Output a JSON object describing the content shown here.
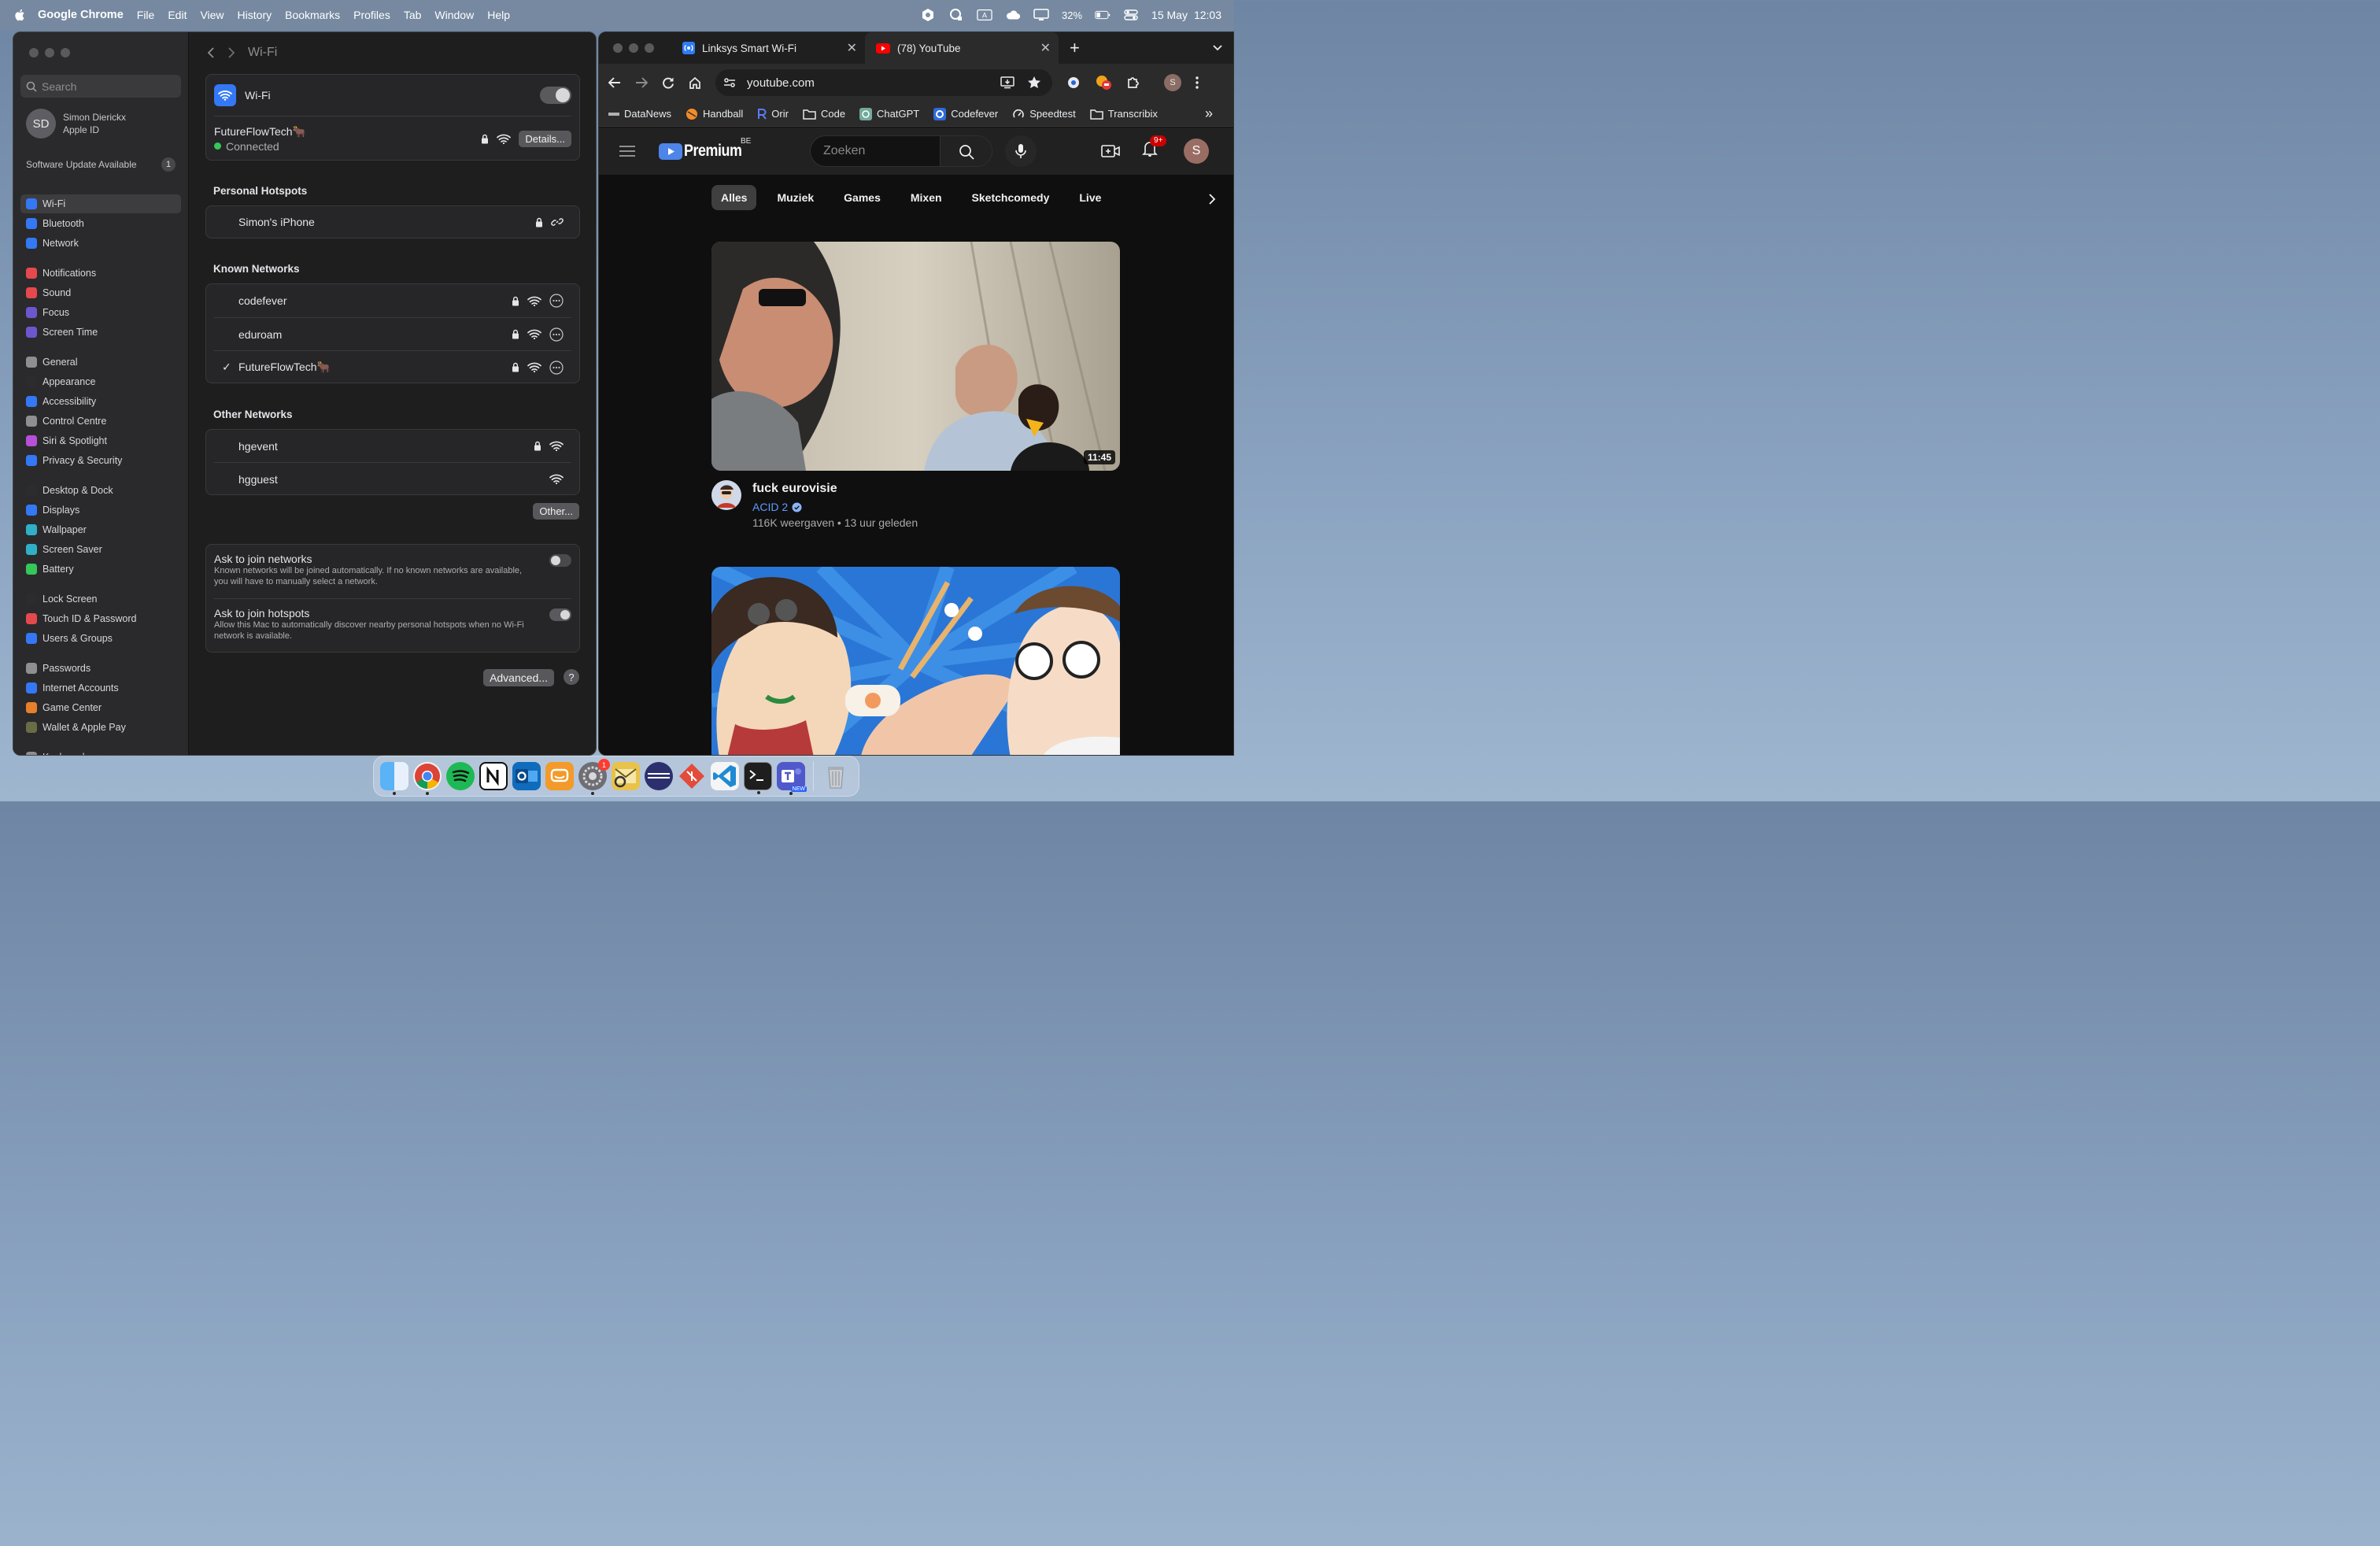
{
  "menubar": {
    "app_name": "Google Chrome",
    "items": [
      "File",
      "Edit",
      "View",
      "History",
      "Bookmarks",
      "Profiles",
      "Tab",
      "Window",
      "Help"
    ],
    "battery": "32%",
    "date": "15 May",
    "time": "12:03",
    "input_source": "A"
  },
  "settings": {
    "search_placeholder": "Search",
    "account": {
      "initials": "SD",
      "name": "Simon Dierickx",
      "sub": "Apple ID"
    },
    "update": {
      "label": "Software Update Available",
      "count": "1"
    },
    "sidebar": [
      {
        "label": "Wi-Fi",
        "color": "#3478f6",
        "active": true
      },
      {
        "label": "Bluetooth",
        "color": "#3478f6"
      },
      {
        "label": "Network",
        "color": "#3478f6"
      },
      {
        "label": "Notifications",
        "color": "#e5484d"
      },
      {
        "label": "Sound",
        "color": "#e5484d"
      },
      {
        "label": "Focus",
        "color": "#6e56cf"
      },
      {
        "label": "Screen Time",
        "color": "#6e56cf"
      },
      {
        "label": "General",
        "color": "#8e8e93"
      },
      {
        "label": "Appearance",
        "color": "#2c2c2e"
      },
      {
        "label": "Accessibility",
        "color": "#3478f6"
      },
      {
        "label": "Control Centre",
        "color": "#8e8e93"
      },
      {
        "label": "Siri & Spotlight",
        "color": "#b84fd8"
      },
      {
        "label": "Privacy & Security",
        "color": "#3478f6"
      },
      {
        "label": "Desktop & Dock",
        "color": "#2c2c2e"
      },
      {
        "label": "Displays",
        "color": "#3478f6"
      },
      {
        "label": "Wallpaper",
        "color": "#30b0c7"
      },
      {
        "label": "Screen Saver",
        "color": "#30b0c7"
      },
      {
        "label": "Battery",
        "color": "#34c759"
      },
      {
        "label": "Lock Screen",
        "color": "#2c2c2e"
      },
      {
        "label": "Touch ID & Password",
        "color": "#e5484d"
      },
      {
        "label": "Users & Groups",
        "color": "#3478f6"
      },
      {
        "label": "Passwords",
        "color": "#8e8e93"
      },
      {
        "label": "Internet Accounts",
        "color": "#3478f6"
      },
      {
        "label": "Game Center",
        "color": "#e87f2b"
      },
      {
        "label": "Wallet & Apple Pay",
        "color": "#6b6b45"
      },
      {
        "label": "Keyboard",
        "color": "#8e8e93"
      }
    ],
    "page_title": "Wi-Fi",
    "wifi": {
      "label": "Wi-Fi",
      "network": "FutureFlowTech🐂",
      "status": "Connected",
      "details_button": "Details..."
    },
    "hotspots": {
      "title": "Personal Hotspots",
      "items": [
        "Simon's iPhone"
      ]
    },
    "known": {
      "title": "Known Networks",
      "items": [
        "codefever",
        "eduroam",
        "FutureFlowTech🐂"
      ],
      "checked": "✓"
    },
    "other": {
      "title": "Other Networks",
      "items": [
        "hgevent",
        "hgguest"
      ],
      "other_button": "Other..."
    },
    "ask_networks": {
      "title": "Ask to join networks",
      "desc": "Known networks will be joined automatically. If no known networks are available, you will have to manually select a network."
    },
    "ask_hotspots": {
      "title": "Ask to join hotspots",
      "desc": "Allow this Mac to automatically discover nearby personal hotspots when no Wi-Fi network is available."
    },
    "advanced_button": "Advanced...",
    "help_button": "?"
  },
  "chrome": {
    "tabs": [
      {
        "title": "Linksys Smart Wi-Fi",
        "active": false
      },
      {
        "title": "(78) YouTube",
        "active": true
      }
    ],
    "new_tab": "+",
    "url": "youtube.com",
    "bookmarks": [
      "DataNews",
      "Handball",
      "Orir",
      "Code",
      "ChatGPT",
      "Codefever",
      "Speedtest",
      "Transcribix"
    ],
    "profile_initial": "S",
    "more_bookmarks": "»"
  },
  "youtube": {
    "logo": "Premium",
    "region": "BE",
    "search_placeholder": "Zoeken",
    "notif_count": "9+",
    "avatar": "S",
    "chips": [
      "Alles",
      "Muziek",
      "Games",
      "Mixen",
      "Sketchcomedy",
      "Live"
    ],
    "video1": {
      "title": "fuck eurovisie",
      "channel": "ACID 2",
      "meta": "116K weergaven • 13 uur geleden",
      "duration": "11:45"
    }
  },
  "dock": {
    "badge": "1",
    "new_label": "NEW"
  },
  "colors": {
    "accent": "#3478f6",
    "yt_red": "#ff0000",
    "connected": "#34c759"
  }
}
